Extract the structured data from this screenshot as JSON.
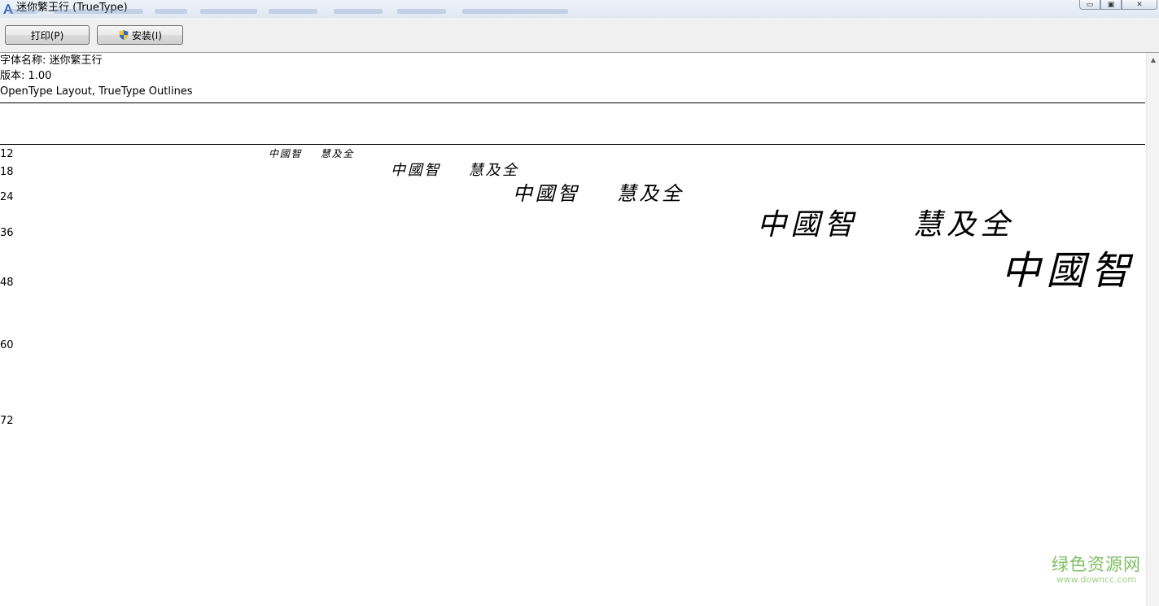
{
  "window": {
    "title": "迷你繁王行 (TrueType)",
    "controls": {
      "minimize": "▭",
      "maximize": "▣",
      "close": "✕"
    }
  },
  "toolbar": {
    "print_label": "打印(P)",
    "install_label": "安装(I)"
  },
  "font_info": {
    "name_line": "字体名称: 迷你繁王行",
    "version_line": "版本: 1.00",
    "outline_line": "OpenType Layout, TrueType Outlines"
  },
  "samples": [
    {
      "size": "12",
      "text": "中國智    慧及全"
    },
    {
      "size": "18",
      "text": "中國智    慧及全"
    },
    {
      "size": "24",
      "text": "中國智    慧及全"
    },
    {
      "size": "36",
      "text": "中國智    慧及全"
    },
    {
      "size": "48",
      "text": "中國智"
    },
    {
      "size": "60",
      "text": ""
    },
    {
      "size": "72",
      "text": ""
    }
  ],
  "watermark": {
    "main": "绿色资源网",
    "sub": "www.downcc.com"
  },
  "colors": {
    "watermark_green": "#7fbf62",
    "toolbar_bg": "#f0f0f0",
    "titlebar_bg": "#dfe8f4"
  }
}
